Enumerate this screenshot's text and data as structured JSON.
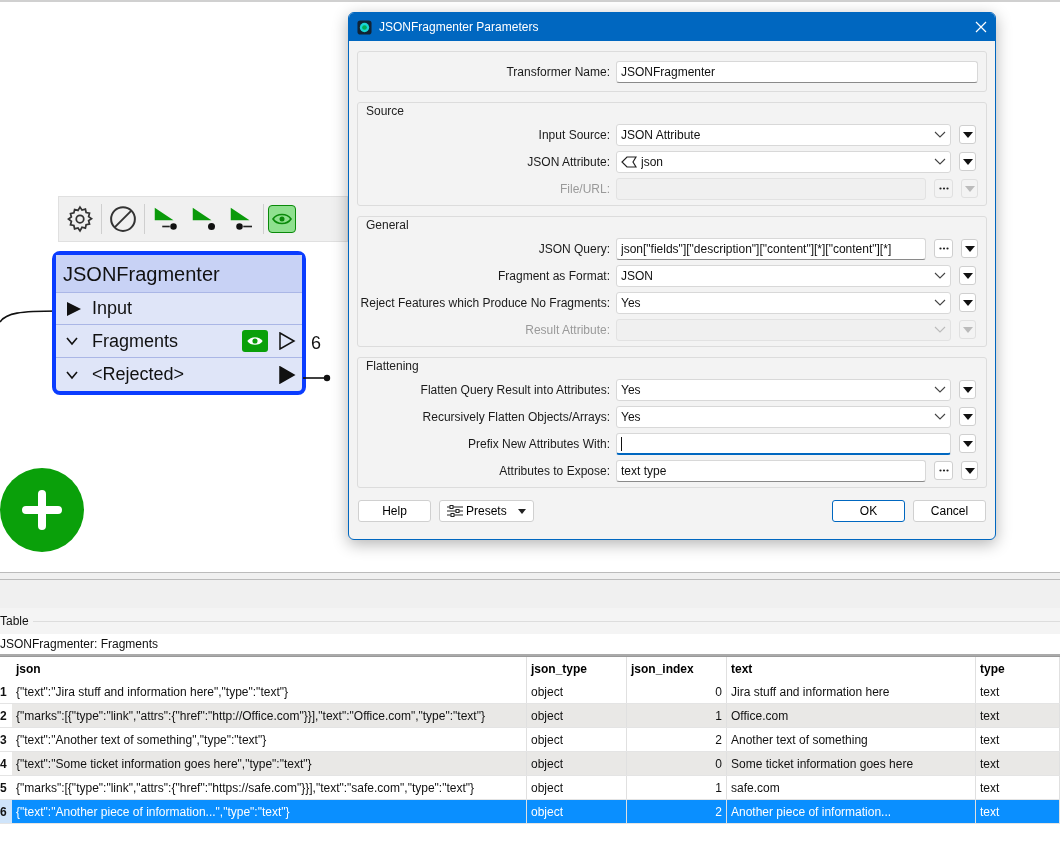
{
  "canvas": {
    "toolbar": [
      {
        "kind": "settings",
        "on": false
      },
      {
        "kind": "disable",
        "on": false
      },
      {
        "kind": "run_to",
        "on": false
      },
      {
        "kind": "run_this",
        "on": false
      },
      {
        "kind": "run_from",
        "on": false
      },
      {
        "kind": "inspect",
        "on": true
      }
    ],
    "node": {
      "title": "JSONFragmenter",
      "input": {
        "label": "Input"
      },
      "outputs": [
        {
          "label": "Fragments",
          "count": "6",
          "inspect": true,
          "connected": false
        },
        {
          "label": "<Rejected>",
          "inspect": false,
          "connected": true
        }
      ]
    }
  },
  "dialog": {
    "title": "JSONFragmenter Parameters",
    "groups": [
      {
        "fields": [
          {
            "label": "Transformer Name:",
            "kind": "text",
            "value": "JSONFragmenter",
            "disabled": false,
            "focused": false,
            "ellipsis": false,
            "menu": false
          }
        ]
      },
      {
        "title": "Source",
        "fields": [
          {
            "label": "Input Source:",
            "kind": "combo",
            "value": "JSON Attribute",
            "disabled": false,
            "focused": false,
            "ellipsis": false,
            "menu": true
          },
          {
            "label": "JSON Attribute:",
            "kind": "attribute",
            "value": "json",
            "disabled": false,
            "focused": false,
            "ellipsis": false,
            "menu": true
          },
          {
            "label": "File/URL:",
            "kind": "text",
            "disabled": true,
            "focused": false,
            "ellipsis": true,
            "menu": true
          }
        ]
      },
      {
        "title": "General",
        "fields": [
          {
            "label": "JSON Query:",
            "kind": "text",
            "value": "json[\"fields\"][\"description\"][\"content\"][*][\"content\"][*]",
            "disabled": false,
            "focused": false,
            "ellipsis": true,
            "menu": true
          },
          {
            "label": "Fragment as Format:",
            "kind": "combo",
            "value": "JSON",
            "disabled": false,
            "focused": false,
            "ellipsis": false,
            "menu": true
          },
          {
            "label": "Reject Features which Produce No Fragments:",
            "kind": "combo",
            "value": "Yes",
            "disabled": false,
            "focused": false,
            "ellipsis": false,
            "menu": true
          },
          {
            "label": "Result Attribute:",
            "kind": "combo",
            "disabled": true,
            "focused": false,
            "ellipsis": false,
            "menu": true
          }
        ]
      },
      {
        "title": "Flattening",
        "fields": [
          {
            "label": "Flatten Query Result into Attributes:",
            "kind": "combo",
            "value": "Yes",
            "disabled": false,
            "focused": false,
            "ellipsis": false,
            "menu": true
          },
          {
            "label": "Recursively Flatten Objects/Arrays:",
            "kind": "combo",
            "value": "Yes",
            "disabled": false,
            "focused": false,
            "ellipsis": false,
            "menu": true
          },
          {
            "label": "Prefix New Attributes With:",
            "kind": "text",
            "disabled": false,
            "focused": true,
            "ellipsis": false,
            "menu": true
          },
          {
            "label": "Attributes to Expose:",
            "kind": "text",
            "value": "text type",
            "disabled": false,
            "focused": false,
            "ellipsis": true,
            "menu": true
          }
        ]
      }
    ],
    "buttons": [
      {
        "label": "Help",
        "kind": "plain"
      },
      {
        "label": "Presets",
        "kind": "presets"
      },
      {
        "label": "OK",
        "kind": "default"
      },
      {
        "label": "Cancel",
        "kind": "plain"
      }
    ]
  },
  "panel": {
    "title": "Table",
    "subtitle": "JSONFragmenter: Fragments",
    "table": {
      "columns": [
        "json",
        "json_type",
        "json_index",
        "text",
        "type"
      ],
      "rows": [
        {
          "number": "1",
          "cells": [
            "{\"text\":\"Jira stuff and information here\",\"type\":\"text\"}",
            "object",
            "0",
            "Jira stuff and information here",
            "text"
          ],
          "selected": false
        },
        {
          "number": "2",
          "cells": [
            "{\"marks\":[{\"type\":\"link\",\"attrs\":{\"href\":\"http://Office.com\"}}],\"text\":\"Office.com\",\"type\":\"text\"}",
            "object",
            "1",
            "Office.com",
            "text"
          ],
          "selected": false
        },
        {
          "number": "3",
          "cells": [
            "{\"text\":\"Another text of something\",\"type\":\"text\"}",
            "object",
            "2",
            "Another text of something",
            "text"
          ],
          "selected": false
        },
        {
          "number": "4",
          "cells": [
            "{\"text\":\"Some ticket information goes here\",\"type\":\"text\"}",
            "object",
            "0",
            "Some ticket information goes here",
            "text"
          ],
          "selected": false
        },
        {
          "number": "5",
          "cells": [
            "{\"marks\":[{\"type\":\"link\",\"attrs\":{\"href\":\"https://safe.com\"}}],\"text\":\"safe.com\",\"type\":\"text\"}",
            "object",
            "1",
            "safe.com",
            "text"
          ],
          "selected": false
        },
        {
          "number": "6",
          "cells": [
            "{\"text\":\"Another piece of information...\",\"type\":\"text\"}",
            "object",
            "2",
            "Another piece of information...",
            "text"
          ],
          "selected": true
        }
      ]
    }
  }
}
